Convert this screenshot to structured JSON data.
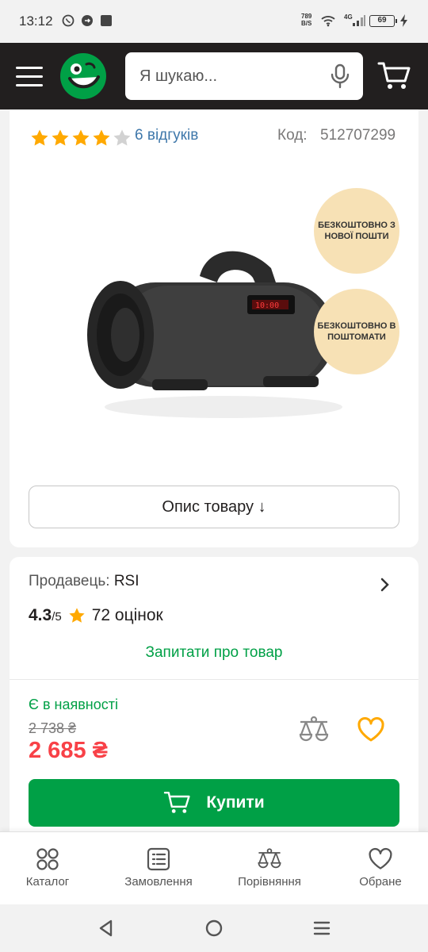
{
  "status_bar": {
    "time": "13:12",
    "net_speed_value": "789",
    "net_speed_unit": "B/S",
    "network": "4G",
    "battery": "69"
  },
  "header": {
    "search_placeholder": "Я шукаю..."
  },
  "product": {
    "rating_stars": 4,
    "reviews": "6 відгуків",
    "code_label": "Код:",
    "code_value": "512707299",
    "badge_1": "БЕЗКОШТОВНО З НОВОЇ ПОШТИ",
    "badge_2": "БЕЗКОШТОВНО В ПОШТОМАТИ",
    "description_button": "Опис товару ↓"
  },
  "seller": {
    "label": "Продавець:",
    "name": "RSI",
    "score": "4.3",
    "score_of": "/5",
    "ratings_count": "72 оцінок",
    "ask_link": "Запитати про товар"
  },
  "purchase": {
    "availability": "Є в наявності",
    "old_price": "2 738 ₴",
    "new_price": "2 685 ₴",
    "buy_label": "Купити"
  },
  "bottom_nav": {
    "items": [
      {
        "label": "Каталог",
        "icon": "grid-icon"
      },
      {
        "label": "Замовлення",
        "icon": "list-icon"
      },
      {
        "label": "Порівняння",
        "icon": "scales-icon"
      },
      {
        "label": "Обране",
        "icon": "heart-icon"
      }
    ]
  },
  "colors": {
    "header_bg": "#221f1f",
    "accent_green": "#00a046",
    "price_red": "#f84147",
    "star_yellow": "#ffa900",
    "link_blue": "#3e77aa",
    "badge_bg": "#f7e1b5"
  }
}
